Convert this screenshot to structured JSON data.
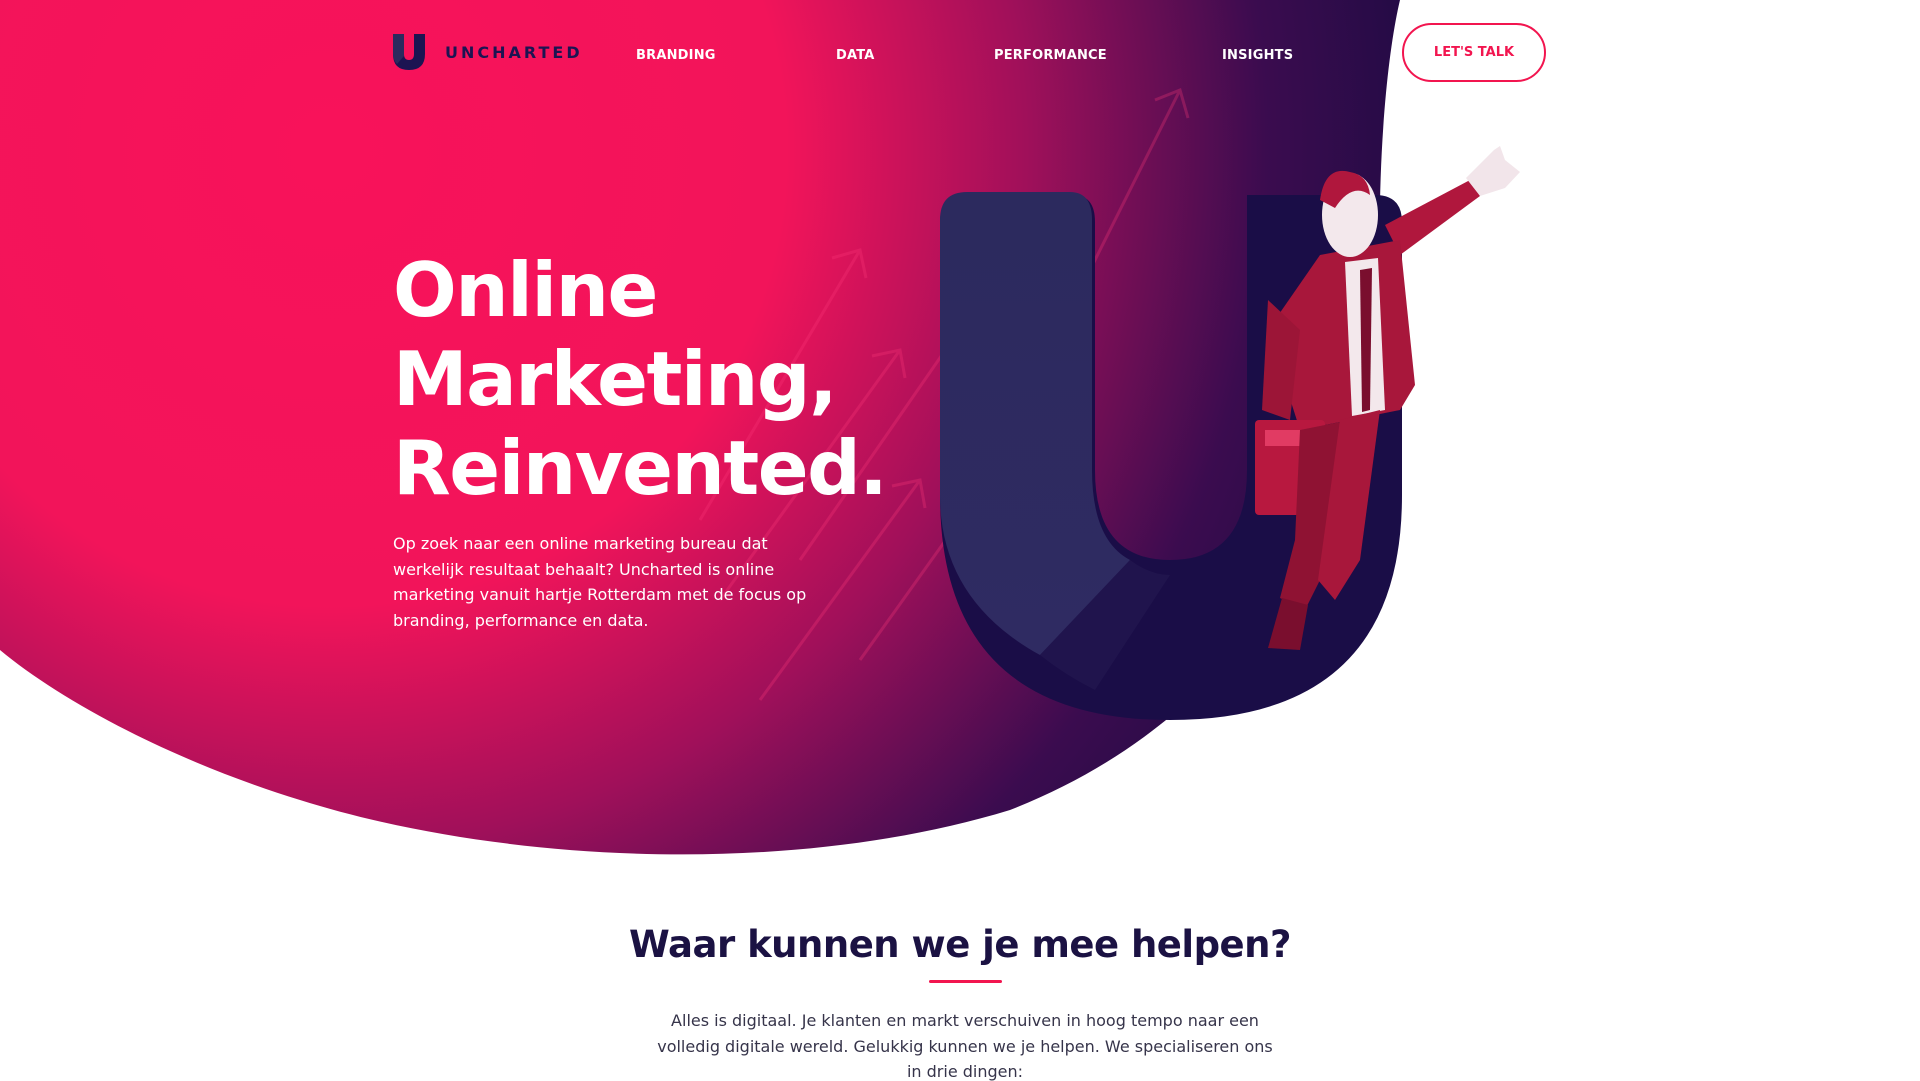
{
  "brand": {
    "name": "UNCHARTED",
    "colors": {
      "accent": "#f2154f",
      "navy": "#1c1452",
      "purple": "#2b2a5e",
      "white": "#ffffff"
    }
  },
  "nav": {
    "items": [
      {
        "label": "BRANDING"
      },
      {
        "label": "DATA"
      },
      {
        "label": "PERFORMANCE"
      },
      {
        "label": "INSIGHTS"
      }
    ],
    "cta_label": "LET'S TALK"
  },
  "hero": {
    "title_lines": [
      "Online",
      "Marketing,",
      "Reinvented."
    ],
    "body_lines": [
      "Op zoek naar een online marketing bureau dat",
      "werkelijk resultaat behaalt? Uncharted is online",
      "marketing vanuit hartje Rotterdam met de focus op",
      "branding, performance en data."
    ],
    "illustration": {
      "icon": "businessman-flying-icon",
      "shape": "u-logo-shape"
    }
  },
  "section": {
    "title": "Waar kunnen we je mee helpen?",
    "body_lines": [
      "Alles is digitaal. Je klanten en markt verschuiven in hoog tempo naar een",
      "volledig digitale wereld. Gelukkig kunnen we je helpen. We specialiseren ons",
      "in drie dingen:"
    ]
  }
}
